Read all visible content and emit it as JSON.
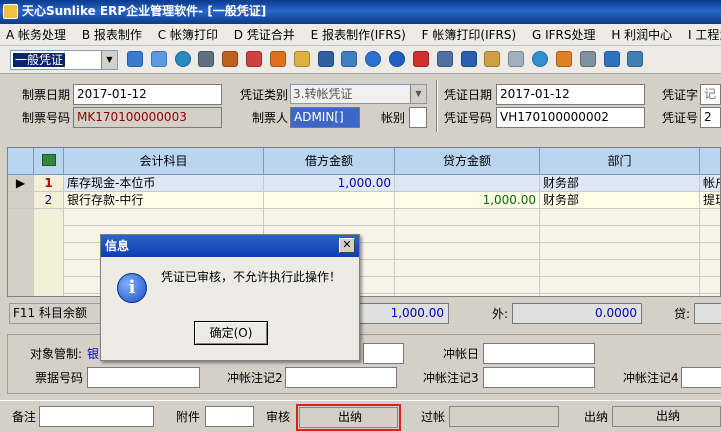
{
  "window": {
    "title": "天心Sunlike ERP企业管理软件- [一般凭证]"
  },
  "menu": [
    "A 帐务处理",
    "B 报表制作",
    "C 帐簿打印",
    "D 凭证合并",
    "E 报表制作(IFRS)",
    "F 帐簿打印(IFRS)",
    "G IFRS处理",
    "H 利润中心",
    "I 工程业报表"
  ],
  "toolbar": {
    "voucher_type_combo": "一般凭证"
  },
  "header": {
    "date_label": "制票日期",
    "date_value": "2017-01-12",
    "number_label": "制票号码",
    "number_value": "MK170100000003",
    "class_label": "凭证类别",
    "class_value": "3.转帐凭证",
    "maker_label": "制票人",
    "maker_value": "ADMIN[]",
    "currency_label": "帐别",
    "currency_value": "",
    "vdate_label": "凭证日期",
    "vdate_value": "2017-01-12",
    "vnum_label": "凭证号码",
    "vnum_value": "VH170100000002",
    "vword_label": "凭证字",
    "vword_value": "记",
    "vno_label": "凭证号",
    "vno_value": "2"
  },
  "grid": {
    "columns": [
      "会计科目",
      "借方金额",
      "贷方金额",
      "部门"
    ],
    "rows": [
      {
        "no": "1",
        "account": "库存现金-本位币",
        "debit": "1,000.00",
        "credit": "",
        "dept": "财务部",
        "extra": "帐户"
      },
      {
        "no": "2",
        "account": "银行存款-中行",
        "debit": "",
        "credit": "1,000.00",
        "dept": "财务部",
        "extra": "提现"
      }
    ]
  },
  "summary": {
    "f11_label": "F11 科目余额",
    "debit_total": "1,000.00",
    "out_label": "外:",
    "out_value": "0.0000",
    "credit_label": "贷:"
  },
  "detail": {
    "object_label": "对象管制:",
    "object_value": "银",
    "bill_label": "票据号码",
    "offset_date_label": "冲帐日",
    "offset_note2": "冲帐注记2",
    "offset_note3": "冲帐注记3",
    "offset_note4": "冲帐注记4"
  },
  "status": {
    "note_label": "备注",
    "attach_label": "附件",
    "audit_label": "审核",
    "audit_value": "出纳",
    "post_label": "过帐",
    "cashier_label": "出纳",
    "cashier_value": "出纳"
  },
  "dialog": {
    "title": "信息",
    "message": "凭证已审核，不允许执行此操作！",
    "ok": "确定(O)",
    "close": "✕"
  }
}
